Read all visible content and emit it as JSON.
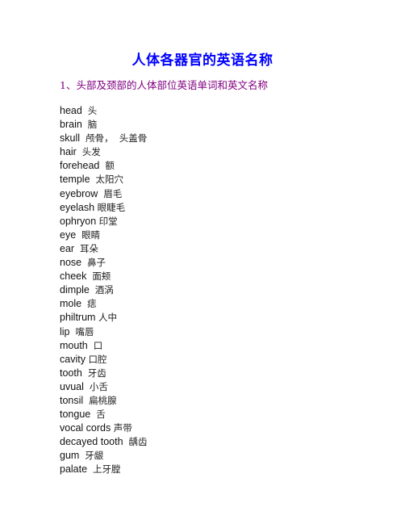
{
  "document": {
    "title": "人体各器官的英语名称",
    "section": {
      "heading": "1、头部及颈部的人体部位英语单词和英文名称",
      "entries": [
        {
          "en": "head",
          "sep": "  ",
          "zh": "头"
        },
        {
          "en": "brain",
          "sep": "  ",
          "zh": "脑"
        },
        {
          "en": "skull",
          "sep": "  ",
          "zh": "颅骨，  头盖骨"
        },
        {
          "en": "hair",
          "sep": "  ",
          "zh": "头发"
        },
        {
          "en": "forehead",
          "sep": "  ",
          "zh": "额"
        },
        {
          "en": "temple",
          "sep": "  ",
          "zh": "太阳穴"
        },
        {
          "en": "eyebrow",
          "sep": "  ",
          "zh": "眉毛"
        },
        {
          "en": "eyelash",
          "sep": " ",
          "zh": "眼睫毛"
        },
        {
          "en": "ophryon",
          "sep": " ",
          "zh": "印堂"
        },
        {
          "en": "eye",
          "sep": "  ",
          "zh": "眼睛"
        },
        {
          "en": "ear",
          "sep": "  ",
          "zh": "耳朵"
        },
        {
          "en": "nose",
          "sep": "  ",
          "zh": "鼻子"
        },
        {
          "en": "cheek",
          "sep": "  ",
          "zh": "面颊"
        },
        {
          "en": "dimple",
          "sep": "  ",
          "zh": "酒涡"
        },
        {
          "en": "mole",
          "sep": "  ",
          "zh": "痣"
        },
        {
          "en": "philtrum",
          "sep": " ",
          "zh": "人中"
        },
        {
          "en": "lip",
          "sep": "  ",
          "zh": "嘴唇"
        },
        {
          "en": "mouth",
          "sep": "  ",
          "zh": "口"
        },
        {
          "en": "cavity",
          "sep": " ",
          "zh": "口腔"
        },
        {
          "en": "tooth",
          "sep": "  ",
          "zh": "牙齿"
        },
        {
          "en": "uvual",
          "sep": "  ",
          "zh": "小舌"
        },
        {
          "en": "tonsil",
          "sep": "  ",
          "zh": "扁桃腺"
        },
        {
          "en": "tongue",
          "sep": "  ",
          "zh": "舌"
        },
        {
          "en": "vocal cords",
          "sep": " ",
          "zh": "声带"
        },
        {
          "en": "decayed tooth",
          "sep": "  ",
          "zh": "龋齿"
        },
        {
          "en": "gum",
          "sep": "  ",
          "zh": "牙龈"
        },
        {
          "en": "palate",
          "sep": "  ",
          "zh": "上牙膛"
        }
      ]
    }
  }
}
